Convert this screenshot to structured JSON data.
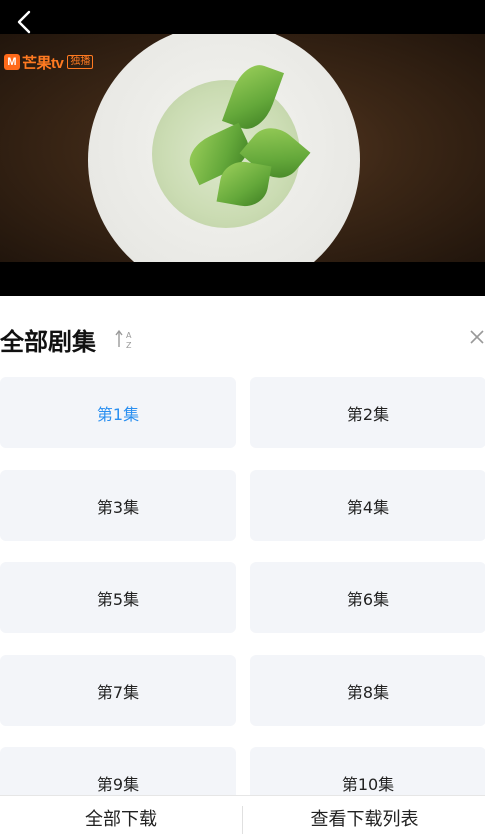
{
  "player": {
    "logo_mark": "M",
    "logo_text": "芒果tv",
    "logo_badge": "独播",
    "back_icon": "chevron-left-icon"
  },
  "episodes_panel": {
    "title": "全部剧集",
    "sort_icon": "sort-az-icon",
    "close_icon": "close-icon",
    "active_color": "#2a8ff0",
    "episodes": [
      {
        "label": "第1集",
        "active": true
      },
      {
        "label": "第2集",
        "active": false
      },
      {
        "label": "第3集",
        "active": false
      },
      {
        "label": "第4集",
        "active": false
      },
      {
        "label": "第5集",
        "active": false
      },
      {
        "label": "第6集",
        "active": false
      },
      {
        "label": "第7集",
        "active": false
      },
      {
        "label": "第8集",
        "active": false
      },
      {
        "label": "第9集",
        "active": false
      },
      {
        "label": "第10集",
        "active": false
      }
    ]
  },
  "bottom_bar": {
    "download_all": "全部下载",
    "view_download_list": "查看下载列表"
  }
}
